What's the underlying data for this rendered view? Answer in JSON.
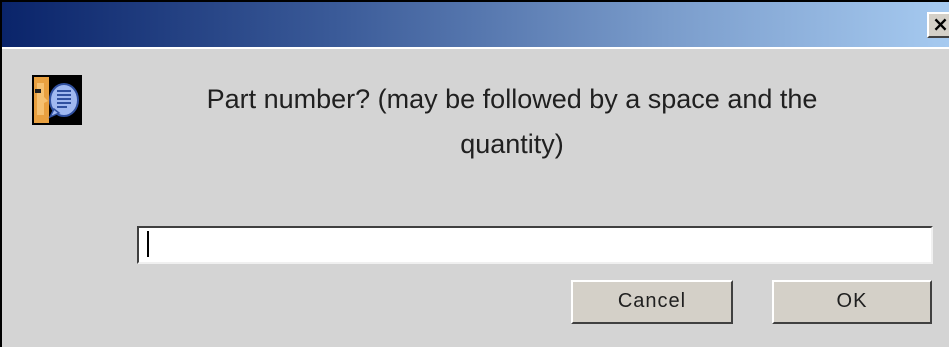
{
  "window": {
    "title": "",
    "close_glyph": "✕"
  },
  "dialog": {
    "icon": "message-icon",
    "message_line1": "Part number? (may be followed by a space and the",
    "message_line2": "quantity)",
    "input_value": "",
    "cancel_label": "Cancel",
    "ok_label": "OK"
  },
  "colors": {
    "titlebar_start": "#0a246a",
    "titlebar_end": "#a6caf0",
    "dialog_bg": "#d4d4d4"
  }
}
